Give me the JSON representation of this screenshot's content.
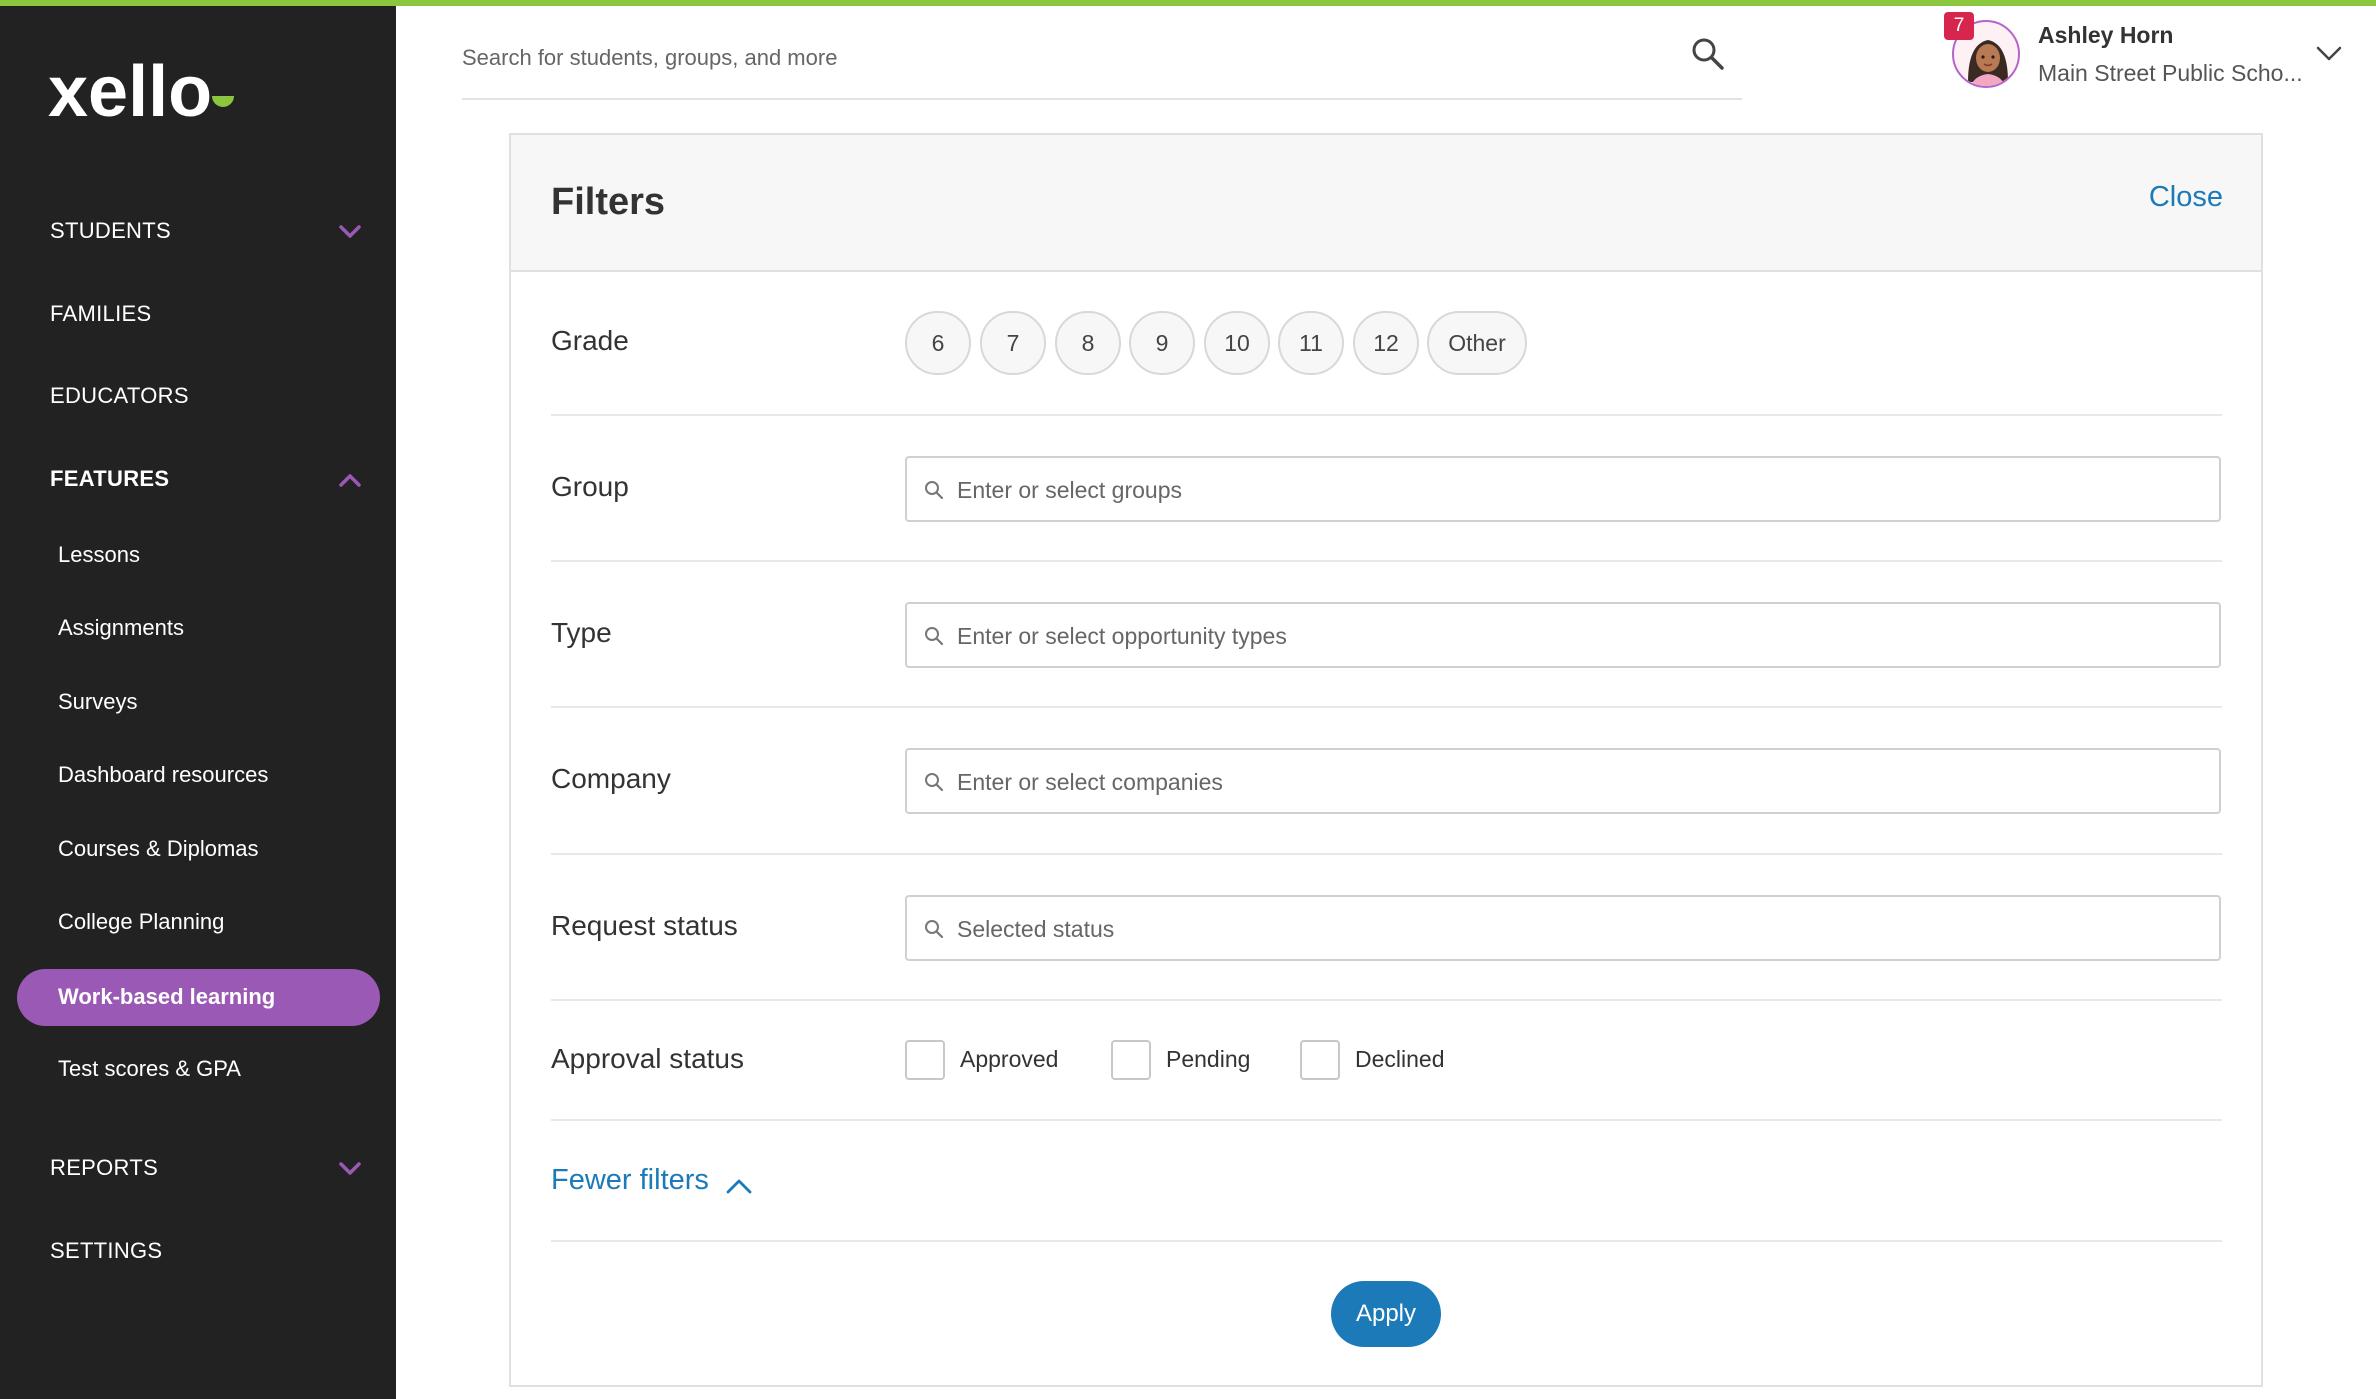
{
  "brand": {
    "logo_text": "xello",
    "accent": "#9b59b6",
    "logo_dot_color": "#8cc63f"
  },
  "sidebar": {
    "items": [
      {
        "label": "STUDENTS",
        "expandable": true,
        "expanded": false
      },
      {
        "label": "FAMILIES"
      },
      {
        "label": "EDUCATORS"
      },
      {
        "label": "FEATURES",
        "expandable": true,
        "expanded": true
      },
      {
        "label": "REPORTS",
        "expandable": true,
        "expanded": false
      },
      {
        "label": "SETTINGS"
      }
    ],
    "features_sub": [
      "Lessons",
      "Assignments",
      "Surveys",
      "Dashboard resources",
      "Courses & Diplomas",
      "College Planning",
      "Work-based learning",
      "Test scores & GPA"
    ],
    "active_item": "Work-based learning"
  },
  "header": {
    "search_placeholder": "Search for students, groups, and more",
    "search_icon": "search-icon",
    "notification_count": "7",
    "user_name": "Ashley Horn",
    "user_school": "Main Street Public Scho..."
  },
  "filters": {
    "title": "Filters",
    "close_label": "Close",
    "grade": {
      "label": "Grade",
      "options": [
        "6",
        "7",
        "8",
        "9",
        "10",
        "11",
        "12",
        "Other"
      ]
    },
    "group": {
      "label": "Group",
      "placeholder": "Enter or select groups"
    },
    "type": {
      "label": "Type",
      "placeholder": "Enter or select opportunity types"
    },
    "company": {
      "label": "Company",
      "placeholder": "Enter or select companies"
    },
    "request_status": {
      "label": "Request status",
      "placeholder": "Selected status"
    },
    "approval_status": {
      "label": "Approval status",
      "options": [
        "Approved",
        "Pending",
        "Declined"
      ]
    },
    "fewer_filters_label": "Fewer filters",
    "apply_label": "Apply"
  }
}
